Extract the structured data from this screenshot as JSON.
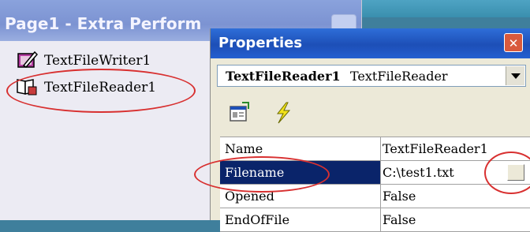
{
  "designer": {
    "title": "Page1 - Extra Perform",
    "components": [
      {
        "label": "TextFileWriter1",
        "icon": "writer-component-icon"
      },
      {
        "label": "TextFileReader1",
        "icon": "reader-component-icon"
      }
    ]
  },
  "properties": {
    "title": "Properties",
    "close_glyph": "✕",
    "selected_object": {
      "name": "TextFileReader1",
      "type": "TextFileReader"
    },
    "toolbar": [
      "properties-page-icon",
      "events-lightning-icon"
    ],
    "rows": [
      {
        "name": "Name",
        "value": "TextFileReader1"
      },
      {
        "name": "Filename",
        "value": "C:\\test1.txt",
        "selected": true
      },
      {
        "name": "Opened",
        "value": "False"
      },
      {
        "name": "EndOfFile",
        "value": "False"
      }
    ]
  },
  "colors": {
    "selection": "#0a246a",
    "annotation": "#d83030",
    "title_bar": "#1d4fb7"
  }
}
